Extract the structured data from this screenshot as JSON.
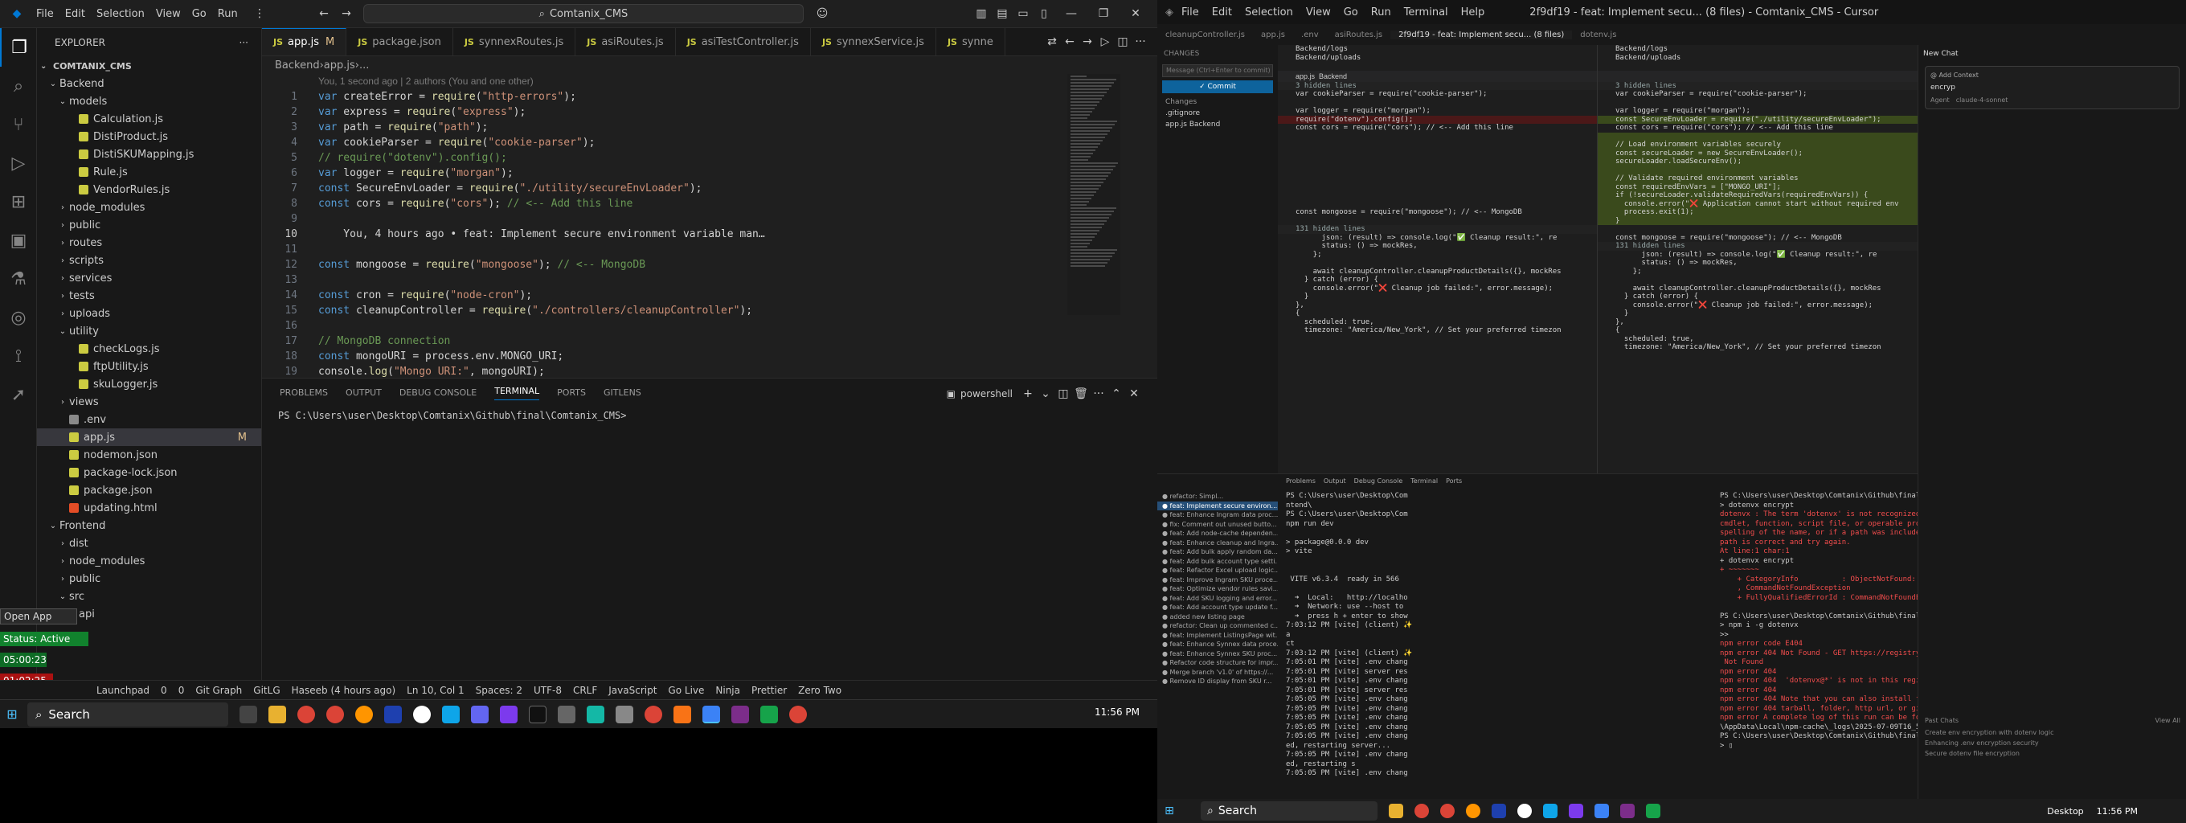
{
  "screen1": {
    "menu": [
      "File",
      "Edit",
      "Selection",
      "View",
      "Go",
      "Run"
    ],
    "search": "Comtanix_CMS",
    "explorer": {
      "title": "EXPLORER",
      "root": "COMTANIX_CMS"
    },
    "tree": [
      {
        "name": "Backend",
        "type": "folder",
        "open": true,
        "level": 1
      },
      {
        "name": "models",
        "type": "folder",
        "open": true,
        "level": 2
      },
      {
        "name": "Calculation.js",
        "type": "js",
        "level": 3
      },
      {
        "name": "DistiProduct.js",
        "type": "js",
        "level": 3
      },
      {
        "name": "DistiSKUMapping.js",
        "type": "js",
        "level": 3
      },
      {
        "name": "Rule.js",
        "type": "js",
        "level": 3
      },
      {
        "name": "VendorRules.js",
        "type": "js",
        "level": 3
      },
      {
        "name": "node_modules",
        "type": "folder",
        "level": 2
      },
      {
        "name": "public",
        "type": "folder",
        "level": 2
      },
      {
        "name": "routes",
        "type": "folder",
        "level": 2
      },
      {
        "name": "scripts",
        "type": "folder",
        "level": 2
      },
      {
        "name": "services",
        "type": "folder",
        "level": 2
      },
      {
        "name": "tests",
        "type": "folder",
        "level": 2
      },
      {
        "name": "uploads",
        "type": "folder",
        "level": 2
      },
      {
        "name": "utility",
        "type": "folder",
        "open": true,
        "level": 2
      },
      {
        "name": "checkLogs.js",
        "type": "js",
        "level": 3
      },
      {
        "name": "ftpUtility.js",
        "type": "js",
        "level": 3
      },
      {
        "name": "skuLogger.js",
        "type": "js",
        "level": 3
      },
      {
        "name": "views",
        "type": "folder",
        "level": 2
      },
      {
        "name": ".env",
        "type": "env",
        "level": 2
      },
      {
        "name": "app.js",
        "type": "js",
        "level": 2,
        "selected": true,
        "mod": "M"
      },
      {
        "name": "nodemon.json",
        "type": "json",
        "level": 2
      },
      {
        "name": "package-lock.json",
        "type": "json",
        "level": 2
      },
      {
        "name": "package.json",
        "type": "json",
        "level": 2
      },
      {
        "name": "updating.html",
        "type": "html",
        "level": 2
      },
      {
        "name": "Frontend",
        "type": "folder",
        "open": true,
        "level": 1
      },
      {
        "name": "dist",
        "type": "folder",
        "level": 2
      },
      {
        "name": "node_modules",
        "type": "folder",
        "level": 2
      },
      {
        "name": "public",
        "type": "folder",
        "level": 2
      },
      {
        "name": "src",
        "type": "folder",
        "open": true,
        "level": 2
      },
      {
        "name": "api",
        "type": "folder",
        "level": 3
      }
    ],
    "tabs": [
      {
        "label": "app.js",
        "mod": "M",
        "active": true
      },
      {
        "label": "package.json"
      },
      {
        "label": "synnexRoutes.js"
      },
      {
        "label": "asiRoutes.js"
      },
      {
        "label": "asiTestController.js"
      },
      {
        "label": "synnexService.js"
      },
      {
        "label": "synne"
      }
    ],
    "breadcrumb": [
      "Backend",
      "app.js",
      "..."
    ],
    "blame": "You, 1 second ago | 2 authors (You and one other)",
    "ghost": "You, 4 hours ago • feat: Implement secure environment variable man…",
    "code": [
      {
        "n": "1",
        "t": "var createError = require(\"http-errors\");"
      },
      {
        "n": "2",
        "t": "var express = require(\"express\");"
      },
      {
        "n": "3",
        "t": "var path = require(\"path\");"
      },
      {
        "n": "4",
        "t": "var cookieParser = require(\"cookie-parser\");"
      },
      {
        "n": "5",
        "t": "// require(\"dotenv\").config();"
      },
      {
        "n": "6",
        "t": "var logger = require(\"morgan\");"
      },
      {
        "n": "7",
        "t": "const SecureEnvLoader = require(\"./utility/secureEnvLoader\");"
      },
      {
        "n": "8",
        "t": "const cors = require(\"cors\"); // <-- Add this line"
      },
      {
        "n": "9",
        "t": ""
      },
      {
        "n": "10",
        "t": ""
      },
      {
        "n": "11",
        "t": ""
      },
      {
        "n": "12",
        "t": "const mongoose = require(\"mongoose\"); // <-- MongoDB"
      },
      {
        "n": "13",
        "t": ""
      },
      {
        "n": "14",
        "t": "const cron = require(\"node-cron\");"
      },
      {
        "n": "15",
        "t": "const cleanupController = require(\"./controllers/cleanupController\");"
      },
      {
        "n": "16",
        "t": ""
      },
      {
        "n": "17",
        "t": "// MongoDB connection"
      },
      {
        "n": "18",
        "t": "const mongoURI = process.env.MONGO_URI;"
      },
      {
        "n": "19",
        "t": "console.log(\"Mongo URI:\", mongoURI);"
      }
    ],
    "panel_tabs": [
      "PROBLEMS",
      "OUTPUT",
      "DEBUG CONSOLE",
      "TERMINAL",
      "PORTS",
      "GITLENS"
    ],
    "panel_active": "TERMINAL",
    "shell": "powershell",
    "terminal_line": "PS C:\\Users\\user\\Desktop\\Comtanix\\Github\\final\\Comtanix_CMS>",
    "status": [
      "Launchpad",
      "0",
      "0",
      "Git Graph",
      "GitLG",
      "Haseeb (4 hours ago)",
      "Ln 10, Col 1",
      "Spaces: 2",
      "UTF-8",
      "CRLF",
      "JavaScript",
      "Go Live",
      "Ninja",
      "Prettier",
      "Zero Two"
    ],
    "overlay": {
      "open_app": "Open App",
      "status": "Status: Active",
      "time1": "05:00:23",
      "time2": "01:02:25"
    },
    "taskbar_search": "Search",
    "clock": "11:56 PM"
  },
  "screen2": {
    "menu": [
      "File",
      "Edit",
      "Selection",
      "View",
      "Go",
      "Run",
      "Terminal",
      "Help"
    ],
    "title": "2f9df19 - feat: Implement secu... (8 files) - Comtanix_CMS - Cursor",
    "commit_btn": "✓ Commit",
    "message_placeholder": "Message (Ctrl+Enter to commit)",
    "changes": [
      "Changes",
      ".gitignore",
      "app.js  Backend"
    ],
    "diff_left": [
      {
        "t": "Backend/logs",
        "k": "n"
      },
      {
        "t": "Backend/uploads",
        "k": "n"
      },
      {
        "t": "",
        "k": "n"
      },
      {
        "t": "app.js  Backend",
        "k": "h"
      },
      {
        "t": "3 hidden lines",
        "k": "hid"
      },
      {
        "t": "var cookieParser = require(\"cookie-parser\");",
        "k": "n"
      },
      {
        "t": "",
        "k": "n"
      },
      {
        "t": "var logger = require(\"morgan\");",
        "k": "n"
      },
      {
        "t": "require(\"dotenv\").config();",
        "k": "del"
      },
      {
        "t": "const cors = require(\"cors\"); // <-- Add this line",
        "k": "n"
      },
      {
        "t": "",
        "k": "n"
      },
      {
        "t": "",
        "k": "n"
      },
      {
        "t": "",
        "k": "n"
      },
      {
        "t": "",
        "k": "n"
      },
      {
        "t": "",
        "k": "n"
      },
      {
        "t": "",
        "k": "n"
      },
      {
        "t": "",
        "k": "n"
      },
      {
        "t": "",
        "k": "n"
      },
      {
        "t": "",
        "k": "n"
      },
      {
        "t": "const mongoose = require(\"mongoose\"); // <-- MongoDB",
        "k": "n"
      },
      {
        "t": "",
        "k": "n"
      },
      {
        "t": "131 hidden lines",
        "k": "hid"
      },
      {
        "t": "      json: (result) => console.log(\"✅ Cleanup result:\", re",
        "k": "n"
      },
      {
        "t": "      status: () => mockRes,",
        "k": "n"
      },
      {
        "t": "    };",
        "k": "n"
      },
      {
        "t": "",
        "k": "n"
      },
      {
        "t": "    await cleanupController.cleanupProductDetails({}, mockRes",
        "k": "n"
      },
      {
        "t": "  } catch (error) {",
        "k": "n"
      },
      {
        "t": "    console.error(\"❌ Cleanup job failed:\", error.message);",
        "k": "n"
      },
      {
        "t": "  }",
        "k": "n"
      },
      {
        "t": "},",
        "k": "n"
      },
      {
        "t": "{",
        "k": "n"
      },
      {
        "t": "  scheduled: true,",
        "k": "n"
      },
      {
        "t": "  timezone: \"America/New_York\", // Set your preferred timezon",
        "k": "n"
      }
    ],
    "diff_right": [
      {
        "t": "Backend/logs",
        "k": "n"
      },
      {
        "t": "Backend/uploads",
        "k": "n"
      },
      {
        "t": "",
        "k": "n"
      },
      {
        "t": "",
        "k": "h"
      },
      {
        "t": "3 hidden lines",
        "k": "hid"
      },
      {
        "t": "var cookieParser = require(\"cookie-parser\");",
        "k": "n"
      },
      {
        "t": "",
        "k": "n"
      },
      {
        "t": "var logger = require(\"morgan\");",
        "k": "n"
      },
      {
        "t": "const SecureEnvLoader = require(\"./utility/secureEnvLoader\");",
        "k": "add"
      },
      {
        "t": "const cors = require(\"cors\"); // <-- Add this line",
        "k": "n"
      },
      {
        "t": "",
        "k": "add"
      },
      {
        "t": "// Load environment variables securely",
        "k": "add"
      },
      {
        "t": "const secureLoader = new SecureEnvLoader();",
        "k": "add"
      },
      {
        "t": "secureLoader.loadSecureEnv();",
        "k": "add"
      },
      {
        "t": "",
        "k": "add"
      },
      {
        "t": "// Validate required environment variables",
        "k": "add"
      },
      {
        "t": "const requiredEnvVars = [\"MONGO_URI\"];",
        "k": "add"
      },
      {
        "t": "if (!secureLoader.validateRequiredVars(requiredEnvVars)) {",
        "k": "add"
      },
      {
        "t": "  console.error(\"❌ Application cannot start without required env",
        "k": "add"
      },
      {
        "t": "  process.exit(1);",
        "k": "add"
      },
      {
        "t": "}",
        "k": "add"
      },
      {
        "t": "",
        "k": "n"
      },
      {
        "t": "const mongoose = require(\"mongoose\"); // <-- MongoDB",
        "k": "n"
      },
      {
        "t": "131 hidden lines",
        "k": "hid"
      },
      {
        "t": "      json: (result) => console.log(\"✅ Cleanup result:\", re",
        "k": "n"
      },
      {
        "t": "      status: () => mockRes,",
        "k": "n"
      },
      {
        "t": "    };",
        "k": "n"
      },
      {
        "t": "",
        "k": "n"
      },
      {
        "t": "    await cleanupController.cleanupProductDetails({}, mockRes",
        "k": "n"
      },
      {
        "t": "  } catch (error) {",
        "k": "n"
      },
      {
        "t": "    console.error(\"❌ Cleanup job failed:\", error.message);",
        "k": "n"
      },
      {
        "t": "  }",
        "k": "n"
      },
      {
        "t": "},",
        "k": "n"
      },
      {
        "t": "{",
        "k": "n"
      },
      {
        "t": "  scheduled: true,",
        "k": "n"
      },
      {
        "t": "  timezone: \"America/New_York\", // Set your preferred timezon",
        "k": "n"
      }
    ],
    "commits": [
      "refactor: Simpl...",
      "feat: Implement secure environ...",
      "feat: Enhance Ingram data proc...",
      "fix: Comment out unused butto...",
      "feat: Add node-cache dependen...",
      "feat: Enhance cleanup and Ingra...",
      "feat: Add bulk apply random da...",
      "feat: Add bulk account type setti...",
      "feat: Refactor Excel upload logic...",
      "feat: Improve Ingram SKU proce...",
      "feat: Optimize vendor rules savi...",
      "feat: Add SKU logging and error...",
      "feat: Add account type update f...",
      "added new listing page",
      "refactor: Clean up commented c...",
      "feat: Implement ListingsPage wit...",
      "feat: Enhance Synnex data proce...",
      "feat: Enhance Synnex SKU proc...",
      "Refactor code structure for impr...",
      "Merge branch 'v1.0' of https://...",
      "Remove ID display from SKU r..."
    ],
    "term_tabs": [
      "Problems",
      "Output",
      "Debug Console",
      "Terminal",
      "Ports"
    ],
    "term_left": "PS C:\\Users\\user\\Desktop\\Com\nntend\\\nPS C:\\Users\\user\\Desktop\\Com\nnpm run dev\n\n> package@0.0.0 dev\n> vite\n\n\n VITE v6.3.4  ready in 566\n\n  ➜  Local:   http://localho\n  ➜  Network: use --host to\n  ➜  press h + enter to show\n7:03:12 PM [vite] (client) ✨\na\nct\n7:03:12 PM [vite] (client) ✨\n7:05:01 PM [vite] .env chang\n7:05:01 PM [vite] server res\n7:05:01 PM [vite] .env chang\n7:05:01 PM [vite] server res\n7:05:05 PM [vite] .env chang\n7:05:05 PM [vite] .env chang\n7:05:05 PM [vite] .env chang\n7:05:05 PM [vite] .env chang\n7:05:05 PM [vite] .env chang\ned, restarting server...\n7:05:05 PM [vite] .env chang\ned, restarting s\n7:05:05 PM [vite] .env chang",
    "term_right": "PS C:\\Users\\user\\Desktop\\Comtanix\\Github\\final\\Comtanix_CMS\\Backend\n> dotenvx encrypt\ndotenvx : The term 'dotenvx' is not recognized as the name of a\ncmdlet, function, script file, or operable program. Check the\nspelling of the name, or if a path was included, verify that the\npath is correct and try again.\nAt line:1 char:1\n+ dotenvx encrypt\n+ ~~~~~~~\n    + CategoryInfo          : ObjectNotFound: (dotenvx:String) []\n    , CommandNotFoundException\n    + FullyQualifiedErrorId : CommandNotFoundException\n\nPS C:\\Users\\user\\Desktop\\Comtanix\\Github\\final\\Comtanix_CMS\\Backend\n> npm i -g dotenvx\n>>\nnpm error code E404\nnpm error 404 Not Found - GET https://registry.npmjs.org/dotenvx -\n Not Found\nnpm error 404\nnpm error 404  'dotenvx@*' is not in this registry.\nnpm error 404\nnpm error 404 Note that you can also install from a\nnpm error 404 tarball, folder, http url, or git url.\nnpm error A complete log of this run can be found in: C:\\Users\\user\n\\AppData\\Local\\npm-cache\\_logs\\2025-07-09T16_53_17_229Z-debug-0.log\nPS C:\\Users\\user\\Desktop\\Comtanix\\Github\\final\\Comtanix_CMS\\Backend\n> ▯",
    "chat": {
      "title": "New Chat",
      "add_context": "Add Context",
      "input": "encryp",
      "agent": "Agent",
      "model": "claude-4-sonnet",
      "past": "Past Chats",
      "view_all": "View All",
      "past_items": [
        "Create env encryption with dotenv logic",
        "Enhancing .env encryption security",
        "Secure dotenv file encryption"
      ]
    },
    "taskbar_search": "Search",
    "clock": "11:56 PM",
    "desktop": "Desktop"
  }
}
